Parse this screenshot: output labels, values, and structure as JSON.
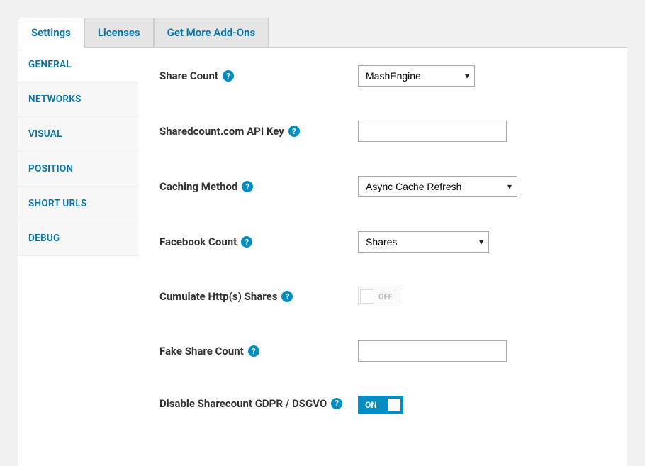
{
  "tabs": {
    "settings": "Settings",
    "licenses": "Licenses",
    "addons": "Get More Add-Ons"
  },
  "sidebar": {
    "general": "GENERAL",
    "networks": "NETWORKS",
    "visual": "VISUAL",
    "position": "POSITION",
    "shorturls": "SHORT URLS",
    "debug": "DEBUG"
  },
  "fields": {
    "share_count": {
      "label": "Share Count",
      "value": "MashEngine"
    },
    "api_key": {
      "label": "Sharedcount.com API Key",
      "value": ""
    },
    "caching": {
      "label": "Caching Method",
      "value": "Async Cache Refresh"
    },
    "fb_count": {
      "label": "Facebook Count",
      "value": "Shares"
    },
    "cumulate": {
      "label": "Cumulate Http(s) Shares",
      "value": "OFF"
    },
    "fake": {
      "label": "Fake Share Count",
      "value": ""
    },
    "gdpr": {
      "label": "Disable Sharecount GDPR / DSGVO",
      "value": "ON"
    }
  },
  "help_glyph": "?"
}
